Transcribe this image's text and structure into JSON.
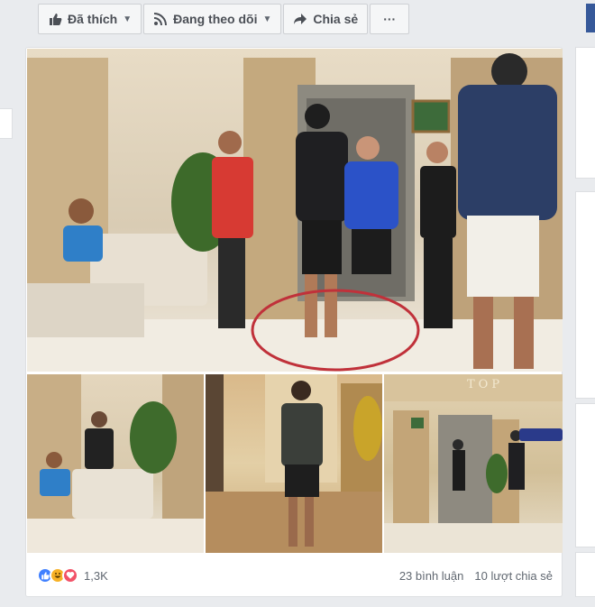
{
  "action_bar": {
    "liked_label": "Đã thích",
    "following_label": "Đang theo dõi",
    "share_label": "Chia sẻ",
    "more_label": "···"
  },
  "photos": {
    "caption_text": "TOP"
  },
  "footer": {
    "reaction_count": "1,3K",
    "comments": "23 bình luận",
    "shares": "10 lượt chia sẻ"
  },
  "colors": {
    "fb_blue": "#365899",
    "like_blue": "#4080ff",
    "haha_yellow": "#f7b125",
    "love_red": "#f25268",
    "circle_red": "#c0313a"
  }
}
